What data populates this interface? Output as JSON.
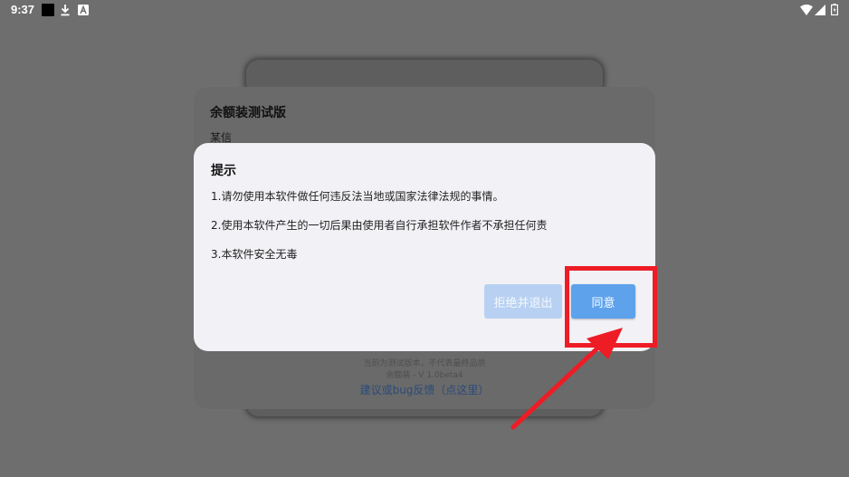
{
  "status_bar": {
    "time": "9:37",
    "icons": [
      "app-square-icon",
      "download-icon",
      "a-badge-icon",
      "wifi-icon",
      "signal-icon",
      "battery-icon"
    ]
  },
  "background_dialog": {
    "title": "余额装测试版",
    "subtitle": "某信",
    "footer_line1": "当前为测试版本，不代表最终品质",
    "footer_line2": "余额装 - V 1.0beta4",
    "footer_link": "建议或bug反馈（点这里）"
  },
  "dialog": {
    "title": "提示",
    "lines": [
      "1.请勿使用本软件做任何违反法当地或国家法律法规的事情。",
      "2.使用本软件产生的一切后果由使用者自行承担软件作者不承担任何责",
      "3.本软件安全无毒"
    ],
    "refuse_label": "拒绝并退出",
    "agree_label": "同意"
  },
  "colors": {
    "scrim": "#6e6e6e",
    "dialog_bg": "#f2f1f5",
    "agree_button": "#5ea2ec",
    "refuse_button": "#b8d1f2",
    "annotation_red": "#ee1c25"
  }
}
